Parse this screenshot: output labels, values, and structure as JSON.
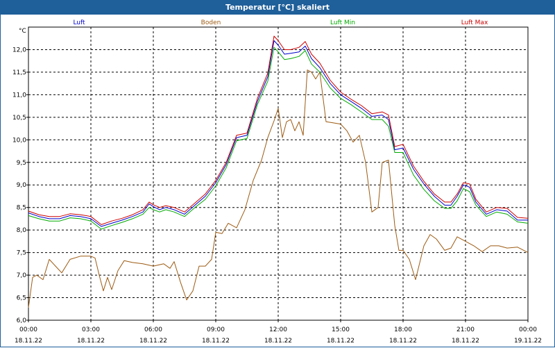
{
  "window": {
    "title": "Temperatur [°C] skaliert"
  },
  "chart_data": {
    "type": "line",
    "title": "Temperatur [°C] skaliert",
    "ylabel": "°C",
    "xlabel": "",
    "ylim": [
      6.0,
      12.5
    ],
    "y_ticks": [
      "6,0",
      "6,5",
      "7,0",
      "7,5",
      "8,0",
      "8,5",
      "9,0",
      "9,5",
      "10,0",
      "10,5",
      "11,0",
      "11,5",
      "12,0"
    ],
    "x_range_hours": [
      0,
      24
    ],
    "x_ticks": [
      {
        "time": "00:00",
        "date": "18.11.22",
        "hour": 0
      },
      {
        "time": "03:00",
        "date": "18.11.22",
        "hour": 3
      },
      {
        "time": "06:00",
        "date": "18.11.22",
        "hour": 6
      },
      {
        "time": "09:00",
        "date": "18.11.22",
        "hour": 9
      },
      {
        "time": "12:00",
        "date": "18.11.22",
        "hour": 12
      },
      {
        "time": "15:00",
        "date": "18.11.22",
        "hour": 15
      },
      {
        "time": "18:00",
        "date": "18.11.22",
        "hour": 18
      },
      {
        "time": "21:00",
        "date": "18.11.22",
        "hour": 21
      },
      {
        "time": "00:00",
        "date": "19.11.22",
        "hour": 24
      }
    ],
    "grid": true,
    "legend_position": "top",
    "series": [
      {
        "name": "Luft",
        "color": "#0000cc",
        "points": [
          [
            0,
            8.38
          ],
          [
            0.5,
            8.3
          ],
          [
            1,
            8.25
          ],
          [
            1.5,
            8.25
          ],
          [
            2,
            8.32
          ],
          [
            2.5,
            8.3
          ],
          [
            3,
            8.25
          ],
          [
            3.5,
            8.08
          ],
          [
            4,
            8.15
          ],
          [
            4.5,
            8.22
          ],
          [
            5,
            8.3
          ],
          [
            5.5,
            8.4
          ],
          [
            5.8,
            8.58
          ],
          [
            6,
            8.52
          ],
          [
            6.3,
            8.45
          ],
          [
            6.6,
            8.5
          ],
          [
            7,
            8.45
          ],
          [
            7.5,
            8.35
          ],
          [
            8,
            8.55
          ],
          [
            8.5,
            8.75
          ],
          [
            9,
            9.05
          ],
          [
            9.5,
            9.45
          ],
          [
            10,
            10.05
          ],
          [
            10.5,
            10.1
          ],
          [
            11,
            10.85
          ],
          [
            11.5,
            11.4
          ],
          [
            11.8,
            12.2
          ],
          [
            12,
            12.1
          ],
          [
            12.3,
            11.9
          ],
          [
            12.6,
            11.92
          ],
          [
            13,
            11.95
          ],
          [
            13.3,
            12.08
          ],
          [
            13.6,
            11.8
          ],
          [
            14,
            11.6
          ],
          [
            14.5,
            11.25
          ],
          [
            15,
            11.0
          ],
          [
            15.5,
            10.85
          ],
          [
            16,
            10.7
          ],
          [
            16.5,
            10.52
          ],
          [
            17,
            10.55
          ],
          [
            17.3,
            10.45
          ],
          [
            17.6,
            9.78
          ],
          [
            18,
            9.82
          ],
          [
            18.5,
            9.35
          ],
          [
            19,
            9.02
          ],
          [
            19.5,
            8.75
          ],
          [
            20,
            8.55
          ],
          [
            20.3,
            8.55
          ],
          [
            20.6,
            8.75
          ],
          [
            20.9,
            9.0
          ],
          [
            21.2,
            8.95
          ],
          [
            21.5,
            8.62
          ],
          [
            22,
            8.35
          ],
          [
            22.5,
            8.45
          ],
          [
            23,
            8.42
          ],
          [
            23.5,
            8.22
          ],
          [
            24,
            8.22
          ]
        ]
      },
      {
        "name": "Boden",
        "color": "#9c5a12",
        "points": [
          [
            0,
            6.28
          ],
          [
            0.2,
            6.95
          ],
          [
            0.4,
            7.0
          ],
          [
            0.7,
            6.9
          ],
          [
            1,
            7.35
          ],
          [
            1.3,
            7.2
          ],
          [
            1.6,
            7.05
          ],
          [
            2,
            7.35
          ],
          [
            2.5,
            7.42
          ],
          [
            3,
            7.42
          ],
          [
            3.2,
            7.38
          ],
          [
            3.4,
            7.0
          ],
          [
            3.6,
            6.65
          ],
          [
            3.8,
            6.95
          ],
          [
            4,
            6.68
          ],
          [
            4.3,
            7.1
          ],
          [
            4.6,
            7.32
          ],
          [
            5,
            7.28
          ],
          [
            5.5,
            7.25
          ],
          [
            6,
            7.2
          ],
          [
            6.5,
            7.25
          ],
          [
            6.8,
            7.15
          ],
          [
            7,
            7.3
          ],
          [
            7.3,
            6.85
          ],
          [
            7.6,
            6.45
          ],
          [
            7.9,
            6.65
          ],
          [
            8.2,
            7.2
          ],
          [
            8.5,
            7.2
          ],
          [
            8.8,
            7.35
          ],
          [
            9,
            7.95
          ],
          [
            9.3,
            7.92
          ],
          [
            9.6,
            8.15
          ],
          [
            10,
            8.05
          ],
          [
            10.4,
            8.45
          ],
          [
            10.8,
            9.1
          ],
          [
            11.2,
            9.55
          ],
          [
            11.5,
            10.05
          ],
          [
            11.8,
            10.42
          ],
          [
            12.0,
            10.7
          ],
          [
            12.2,
            10.05
          ],
          [
            12.4,
            10.4
          ],
          [
            12.6,
            10.45
          ],
          [
            12.8,
            10.2
          ],
          [
            13.0,
            10.4
          ],
          [
            13.2,
            10.1
          ],
          [
            13.4,
            11.55
          ],
          [
            13.6,
            11.5
          ],
          [
            13.8,
            11.35
          ],
          [
            14.0,
            11.5
          ],
          [
            14.3,
            10.4
          ],
          [
            14.6,
            10.38
          ],
          [
            15.0,
            10.35
          ],
          [
            15.3,
            10.2
          ],
          [
            15.6,
            9.95
          ],
          [
            15.9,
            10.1
          ],
          [
            16.2,
            9.5
          ],
          [
            16.5,
            8.4
          ],
          [
            16.8,
            8.5
          ],
          [
            17.0,
            9.5
          ],
          [
            17.3,
            9.55
          ],
          [
            17.6,
            8.1
          ],
          [
            17.8,
            7.55
          ],
          [
            18.0,
            7.55
          ],
          [
            18.3,
            7.35
          ],
          [
            18.6,
            6.9
          ],
          [
            19.0,
            7.65
          ],
          [
            19.3,
            7.9
          ],
          [
            19.6,
            7.8
          ],
          [
            20.0,
            7.55
          ],
          [
            20.3,
            7.6
          ],
          [
            20.6,
            7.85
          ],
          [
            21.0,
            7.75
          ],
          [
            21.4,
            7.65
          ],
          [
            21.8,
            7.52
          ],
          [
            22.2,
            7.65
          ],
          [
            22.6,
            7.65
          ],
          [
            23.0,
            7.6
          ],
          [
            23.5,
            7.62
          ],
          [
            24,
            7.5
          ]
        ]
      },
      {
        "name": "Luft Min",
        "color": "#00aa00",
        "points": [
          [
            0,
            8.32
          ],
          [
            0.5,
            8.25
          ],
          [
            1,
            8.2
          ],
          [
            1.5,
            8.2
          ],
          [
            2,
            8.27
          ],
          [
            2.5,
            8.25
          ],
          [
            3,
            8.2
          ],
          [
            3.5,
            8.02
          ],
          [
            4,
            8.1
          ],
          [
            4.5,
            8.17
          ],
          [
            5,
            8.25
          ],
          [
            5.5,
            8.35
          ],
          [
            5.8,
            8.5
          ],
          [
            6,
            8.45
          ],
          [
            6.3,
            8.4
          ],
          [
            6.6,
            8.45
          ],
          [
            7,
            8.4
          ],
          [
            7.5,
            8.3
          ],
          [
            8,
            8.5
          ],
          [
            8.5,
            8.68
          ],
          [
            9,
            8.98
          ],
          [
            9.5,
            9.38
          ],
          [
            10,
            9.98
          ],
          [
            10.5,
            10.03
          ],
          [
            11,
            10.78
          ],
          [
            11.5,
            11.3
          ],
          [
            11.8,
            12.05
          ],
          [
            12,
            11.95
          ],
          [
            12.3,
            11.78
          ],
          [
            12.6,
            11.8
          ],
          [
            13,
            11.85
          ],
          [
            13.3,
            11.98
          ],
          [
            13.6,
            11.68
          ],
          [
            14,
            11.5
          ],
          [
            14.5,
            11.15
          ],
          [
            15,
            10.92
          ],
          [
            15.5,
            10.78
          ],
          [
            16,
            10.62
          ],
          [
            16.5,
            10.45
          ],
          [
            17,
            10.45
          ],
          [
            17.3,
            10.3
          ],
          [
            17.6,
            9.72
          ],
          [
            18,
            9.72
          ],
          [
            18.5,
            9.22
          ],
          [
            19,
            8.9
          ],
          [
            19.5,
            8.65
          ],
          [
            20,
            8.48
          ],
          [
            20.3,
            8.48
          ],
          [
            20.6,
            8.65
          ],
          [
            20.9,
            8.92
          ],
          [
            21.2,
            8.85
          ],
          [
            21.5,
            8.55
          ],
          [
            22,
            8.3
          ],
          [
            22.5,
            8.4
          ],
          [
            23,
            8.35
          ],
          [
            23.5,
            8.18
          ],
          [
            24,
            8.15
          ]
        ]
      },
      {
        "name": "Luft Max",
        "color": "#cc0000",
        "points": [
          [
            0,
            8.42
          ],
          [
            0.5,
            8.34
          ],
          [
            1,
            8.3
          ],
          [
            1.5,
            8.3
          ],
          [
            2,
            8.36
          ],
          [
            2.5,
            8.34
          ],
          [
            3,
            8.3
          ],
          [
            3.5,
            8.12
          ],
          [
            4,
            8.2
          ],
          [
            4.5,
            8.26
          ],
          [
            5,
            8.34
          ],
          [
            5.5,
            8.45
          ],
          [
            5.8,
            8.62
          ],
          [
            6,
            8.56
          ],
          [
            6.3,
            8.5
          ],
          [
            6.6,
            8.54
          ],
          [
            7,
            8.5
          ],
          [
            7.5,
            8.4
          ],
          [
            8,
            8.6
          ],
          [
            8.5,
            8.8
          ],
          [
            9,
            9.1
          ],
          [
            9.5,
            9.5
          ],
          [
            10,
            10.1
          ],
          [
            10.5,
            10.15
          ],
          [
            11,
            10.92
          ],
          [
            11.5,
            11.48
          ],
          [
            11.8,
            12.3
          ],
          [
            12,
            12.2
          ],
          [
            12.3,
            12.0
          ],
          [
            12.6,
            12.0
          ],
          [
            13,
            12.05
          ],
          [
            13.3,
            12.18
          ],
          [
            13.6,
            11.9
          ],
          [
            14,
            11.7
          ],
          [
            14.5,
            11.32
          ],
          [
            15,
            11.06
          ],
          [
            15.5,
            10.9
          ],
          [
            16,
            10.76
          ],
          [
            16.5,
            10.58
          ],
          [
            17,
            10.62
          ],
          [
            17.3,
            10.55
          ],
          [
            17.6,
            9.85
          ],
          [
            18,
            9.9
          ],
          [
            18.5,
            9.42
          ],
          [
            19,
            9.08
          ],
          [
            19.5,
            8.8
          ],
          [
            20,
            8.62
          ],
          [
            20.3,
            8.62
          ],
          [
            20.6,
            8.8
          ],
          [
            20.9,
            9.05
          ],
          [
            21.2,
            9.02
          ],
          [
            21.5,
            8.68
          ],
          [
            22,
            8.4
          ],
          [
            22.5,
            8.5
          ],
          [
            23,
            8.48
          ],
          [
            23.5,
            8.28
          ],
          [
            24,
            8.26
          ]
        ]
      }
    ]
  }
}
